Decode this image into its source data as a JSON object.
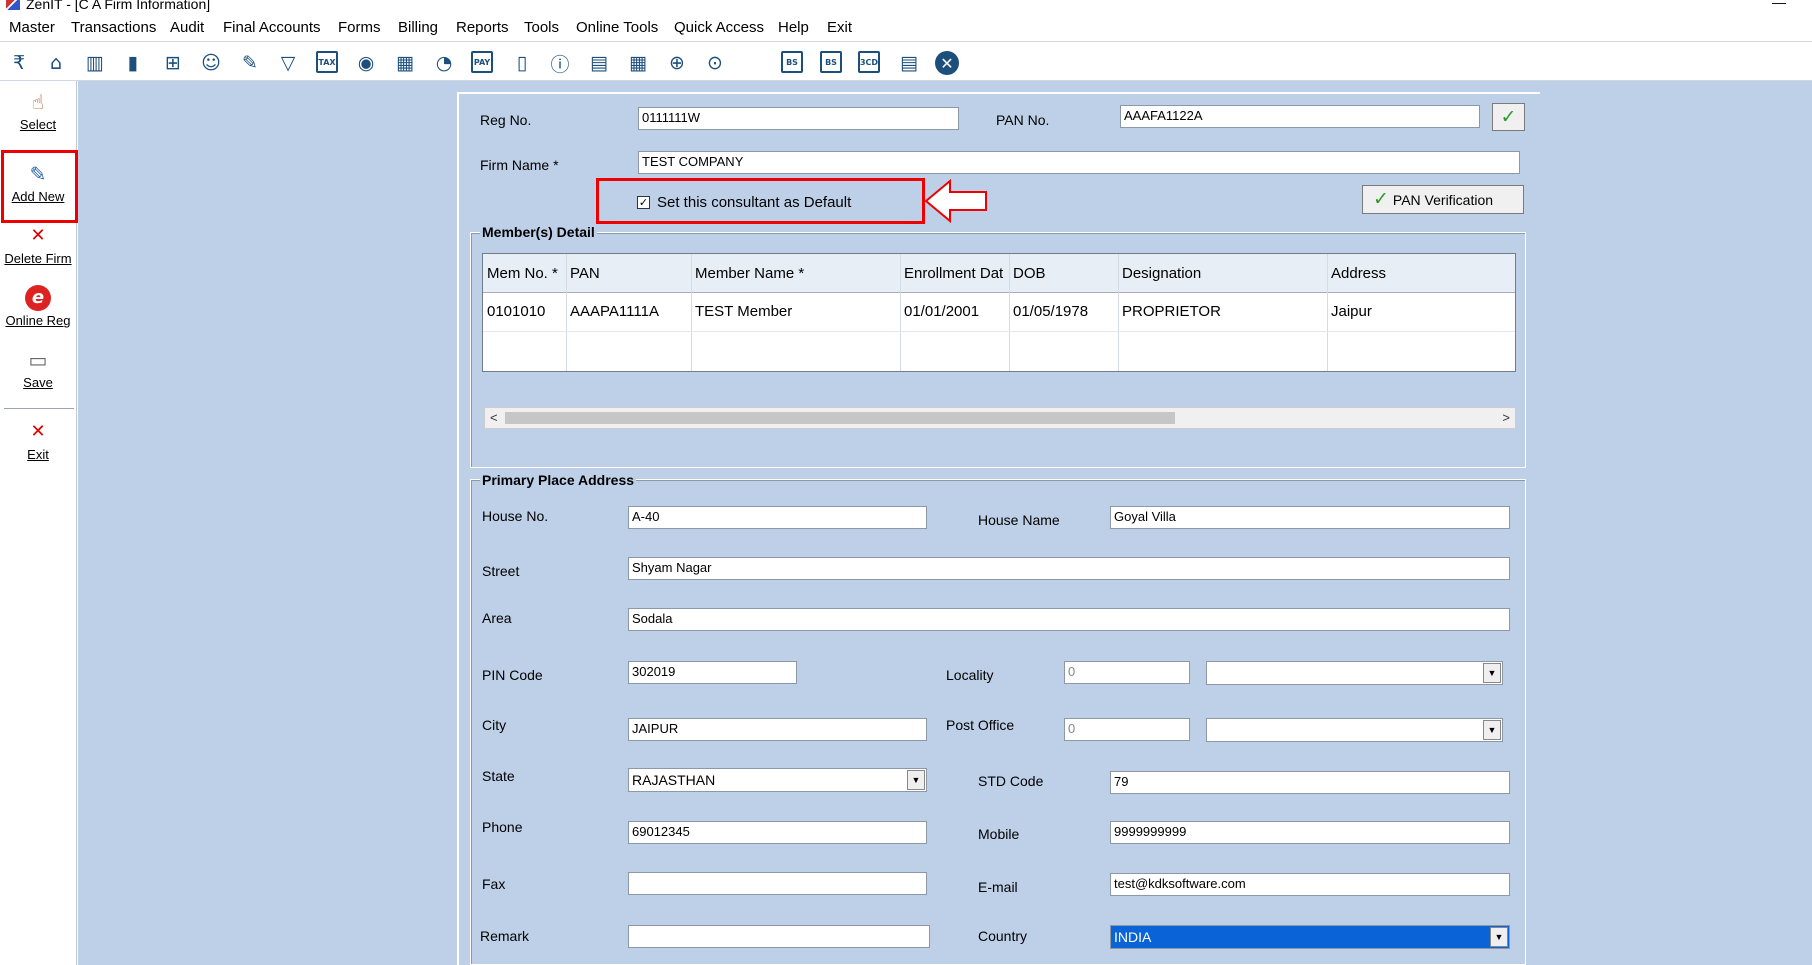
{
  "window": {
    "title": "ZenIT - [C A Firm Information]",
    "minimize": "—"
  },
  "menu": [
    "Master",
    "Transactions",
    "Audit",
    "Final Accounts",
    "Forms",
    "Billing",
    "Reports",
    "Tools",
    "Online Tools",
    "Quick Access",
    "Help",
    "Exit"
  ],
  "toolbar": {
    "icons": [
      "rupee-book-icon",
      "home-icon",
      "buildings-icon",
      "bar-chart-icon",
      "gift-icon",
      "users-icon",
      "pin-icon",
      "filter-icon",
      "tax-icon",
      "audio-icon",
      "calculator-icon",
      "pie-chart-icon",
      "pay-icon",
      "tablet-icon",
      "info-icon",
      "document-icon",
      "calendar-icon",
      "folder-add-icon",
      "folder-view-icon",
      "bs-icon",
      "bs-sch-icon",
      "3cd-icon",
      "form-icon",
      "close-circle-icon"
    ],
    "tax_label": "TAX",
    "pay_label": "PAY",
    "bs_label": "BS",
    "bssch_label": "BS",
    "cd_label": "3CD"
  },
  "sidebar": {
    "select": "Select",
    "add_new": "Add New",
    "delete_firm": "Delete Firm",
    "online_reg": "Online Reg",
    "save": "Save",
    "exit": "Exit"
  },
  "form": {
    "reg_no_label": "Reg No.",
    "reg_no": "0111111W",
    "pan_no_label": "PAN No.",
    "pan_no": "AAAFA1122A",
    "firm_name_label": "Firm Name *",
    "firm_name": "TEST COMPANY",
    "default_label": "Set this consultant as Default",
    "default_checked": true,
    "pan_verify_label": "PAN Verification"
  },
  "members": {
    "title": "Member(s) Detail",
    "columns": [
      "Mem No. *",
      "PAN",
      "Member Name *",
      "Enrollment Dat",
      "DOB",
      "Designation",
      "Address"
    ],
    "rows": [
      [
        "0101010",
        "AAAPA1111A",
        "TEST Member",
        "01/01/2001",
        "01/05/1978",
        "PROPRIETOR",
        "Jaipur"
      ]
    ]
  },
  "address": {
    "title": "Primary Place Address",
    "house_no_label": "House No.",
    "house_no": "A-40",
    "house_name_label": "House Name",
    "house_name": "Goyal Villa",
    "street_label": "Street",
    "street": "Shyam Nagar",
    "area_label": "Area",
    "area": "Sodala",
    "pin_label": "PIN Code",
    "pin": "302019",
    "locality_label": "Locality",
    "locality_code": "0",
    "locality": "",
    "city_label": "City",
    "city": "JAIPUR",
    "post_office_label": "Post Office",
    "post_office_code": "0",
    "post_office": "",
    "state_label": "State",
    "state": "RAJASTHAN",
    "std_label": "STD Code",
    "std": "79",
    "phone_label": "Phone",
    "phone": "69012345",
    "mobile_label": "Mobile",
    "mobile": "9999999999",
    "fax_label": "Fax",
    "fax": "",
    "email_label": "E-mail",
    "email": "test@kdksoftware.com",
    "remark_label": "Remark",
    "remark": "",
    "country_label": "Country",
    "country": "INDIA"
  },
  "colors": {
    "highlight": "#e00000",
    "workarea": "#bed0e8",
    "selection": "#0a64d8"
  }
}
